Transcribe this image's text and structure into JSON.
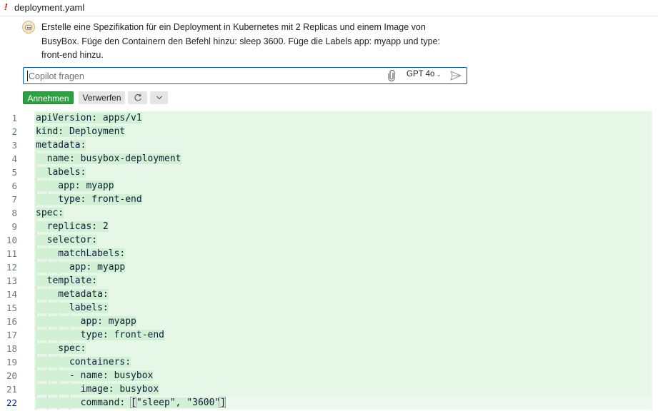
{
  "tab": {
    "icon": "warning-exclamation-icon",
    "title": "deployment.yaml"
  },
  "chat": {
    "avatar": "copilot-avatar-icon",
    "prompt_lines": [
      "Erstelle eine Spezifikation für ein Deployment in Kubernetes mit 2 Replicas und einem Image von",
      "BusyBox. Füge den Containern den Befehl hinzu: sleep 3600. Füge die Labels app: myapp und type:",
      "front-end hinzu."
    ],
    "input": {
      "value": "",
      "placeholder": "Copilot fragen"
    },
    "attach_icon": "paperclip-icon",
    "model": "GPT 4o",
    "send_icon": "send-icon",
    "accept_label": "Annehmen",
    "discard_label": "Verwerfen",
    "rerun_icon": "refresh-icon",
    "more_icon": "chevron-down-icon",
    "accent_color": "#005fb8",
    "accept_color": "#2ea043"
  },
  "editor": {
    "active_line": 22,
    "lines": [
      {
        "n": "1",
        "text": "apiVersion: apps/v1"
      },
      {
        "n": "2",
        "text": "kind: Deployment"
      },
      {
        "n": "3",
        "text": "metadata:"
      },
      {
        "n": "4",
        "text": "  name: busybox-deployment"
      },
      {
        "n": "5",
        "text": "  labels:"
      },
      {
        "n": "6",
        "text": "    app: myapp"
      },
      {
        "n": "7",
        "text": "    type: front-end"
      },
      {
        "n": "8",
        "text": "spec:"
      },
      {
        "n": "9",
        "text": "  replicas: 2"
      },
      {
        "n": "10",
        "text": "  selector:"
      },
      {
        "n": "11",
        "text": "    matchLabels:"
      },
      {
        "n": "12",
        "text": "      app: myapp"
      },
      {
        "n": "13",
        "text": "  template:"
      },
      {
        "n": "14",
        "text": "    metadata:"
      },
      {
        "n": "15",
        "text": "      labels:"
      },
      {
        "n": "16",
        "text": "        app: myapp"
      },
      {
        "n": "17",
        "text": "        type: front-end"
      },
      {
        "n": "18",
        "text": "    spec:"
      },
      {
        "n": "19",
        "text": "      containers:"
      },
      {
        "n": "20",
        "text": "      - name: busybox"
      },
      {
        "n": "21",
        "text": "        image: busybox"
      },
      {
        "n": "22",
        "text": "        command: [\"sleep\", \"3600\"]"
      }
    ],
    "added_line_color": "#e6f6e7"
  }
}
